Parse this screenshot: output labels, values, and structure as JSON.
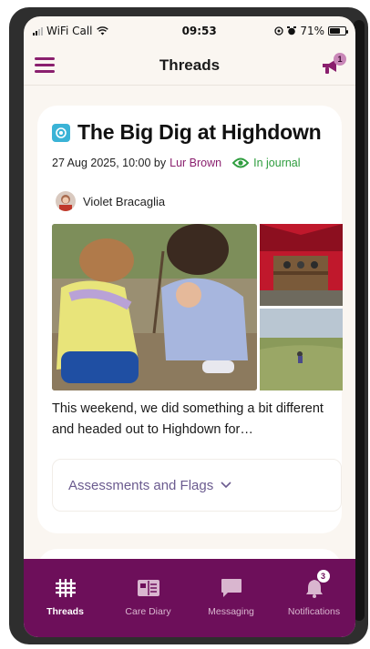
{
  "status_bar": {
    "carrier": "WiFi Call",
    "time": "09:53",
    "battery": "71%",
    "battery_level": 0.71
  },
  "header": {
    "title": "Threads",
    "announcement_badge": "1"
  },
  "post": {
    "title": "The Big Dig at Highdown",
    "date": "27 Aug 2025, 10:00 by",
    "author": "Lur Brown",
    "journal_status": "In journal",
    "child_name": "Violet Bracaglia",
    "body": "This weekend, we did something a bit different and headed out to Highdown for…",
    "assessments_label": "Assessments and Flags"
  },
  "tabs": [
    {
      "label": "Threads",
      "icon": "grid-icon",
      "active": true
    },
    {
      "label": "Care Diary",
      "icon": "book-icon",
      "active": false
    },
    {
      "label": "Messaging",
      "icon": "chat-icon",
      "active": false
    },
    {
      "label": "Notifications",
      "icon": "bell-icon",
      "active": false,
      "badge": "3"
    }
  ],
  "colors": {
    "brand": "#6d0f5a",
    "accent": "#8a1f6e",
    "journal_green": "#2e9d3e",
    "background": "#faf6f1"
  }
}
